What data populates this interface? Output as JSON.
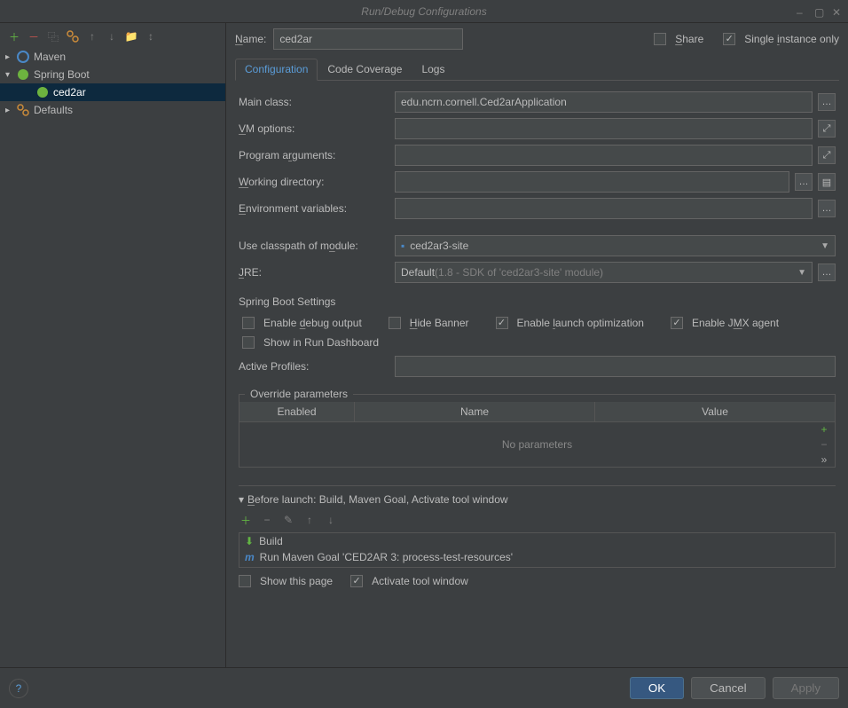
{
  "window": {
    "title": "Run/Debug Configurations"
  },
  "toolbar": {},
  "tree": {
    "maven": "Maven",
    "springboot": "Spring Boot",
    "ced2ar": "ced2ar",
    "defaults": "Defaults"
  },
  "header": {
    "name_label": "Name:",
    "name_value": "ced2ar",
    "share": "Share",
    "single_instance": "Single instance only"
  },
  "tabs": {
    "configuration": "Configuration",
    "code_coverage": "Code Coverage",
    "logs": "Logs"
  },
  "form": {
    "main_class_label": "Main class:",
    "main_class_value": "edu.ncrn.cornell.Ced2arApplication",
    "vm_options_label": "VM options:",
    "vm_options_value": "",
    "program_args_label": "Program arguments:",
    "program_args_value": "",
    "working_dir_label": "Working directory:",
    "working_dir_value": "",
    "env_vars_label": "Environment variables:",
    "env_vars_value": "",
    "classpath_label": "Use classpath of module:",
    "classpath_value": "ced2ar3-site",
    "jre_label": "JRE:",
    "jre_value": "Default ",
    "jre_hint": "(1.8 - SDK of 'ced2ar3-site' module)"
  },
  "spring": {
    "section": "Spring Boot Settings",
    "debug_output": "Enable debug output",
    "hide_banner": "Hide Banner",
    "launch_opt": "Enable launch optimization",
    "jmx": "Enable JMX agent",
    "dashboard": "Show in Run Dashboard",
    "active_profiles_label": "Active Profiles:",
    "active_profiles_value": ""
  },
  "override": {
    "legend": "Override parameters",
    "col_enabled": "Enabled",
    "col_name": "Name",
    "col_value": "Value",
    "empty": "No parameters"
  },
  "before_launch": {
    "header": "Before launch: Build, Maven Goal, Activate tool window",
    "item1": "Build",
    "item2": "Run Maven Goal 'CED2AR 3: process-test-resources'",
    "show_page": "Show this page",
    "activate_window": "Activate tool window"
  },
  "footer": {
    "ok": "OK",
    "cancel": "Cancel",
    "apply": "Apply"
  }
}
